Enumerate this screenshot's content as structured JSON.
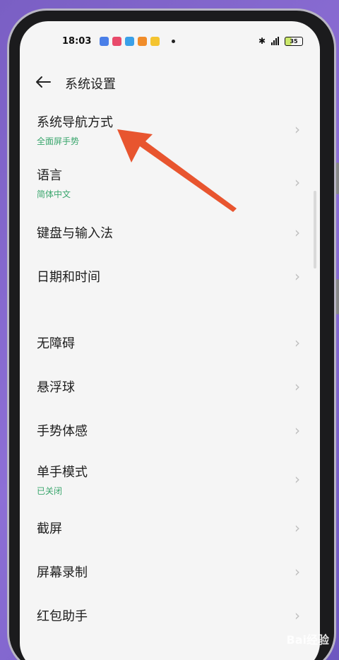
{
  "status": {
    "time": "18:03",
    "battery": "35",
    "app_icon_colors": [
      "#4a7fe8",
      "#e84a6a",
      "#3aa0e8",
      "#f08c2a",
      "#f4c430"
    ]
  },
  "header": {
    "title": "系统设置"
  },
  "items": [
    {
      "label": "系统导航方式",
      "sub": "全面屏手势"
    },
    {
      "label": "语言",
      "sub": "简体中文"
    },
    {
      "label": "键盘与输入法",
      "sub": ""
    },
    {
      "label": "日期和时间",
      "sub": ""
    },
    {
      "label": "无障碍",
      "sub": ""
    },
    {
      "label": "悬浮球",
      "sub": ""
    },
    {
      "label": "手势体感",
      "sub": ""
    },
    {
      "label": "单手模式",
      "sub": "已关闭"
    },
    {
      "label": "截屏",
      "sub": ""
    },
    {
      "label": "屏幕录制",
      "sub": ""
    },
    {
      "label": "红包助手",
      "sub": ""
    }
  ],
  "colors": {
    "accent_green": "#3aa66d",
    "annotation_arrow": "#e8552f"
  },
  "watermark": "Bai经验"
}
